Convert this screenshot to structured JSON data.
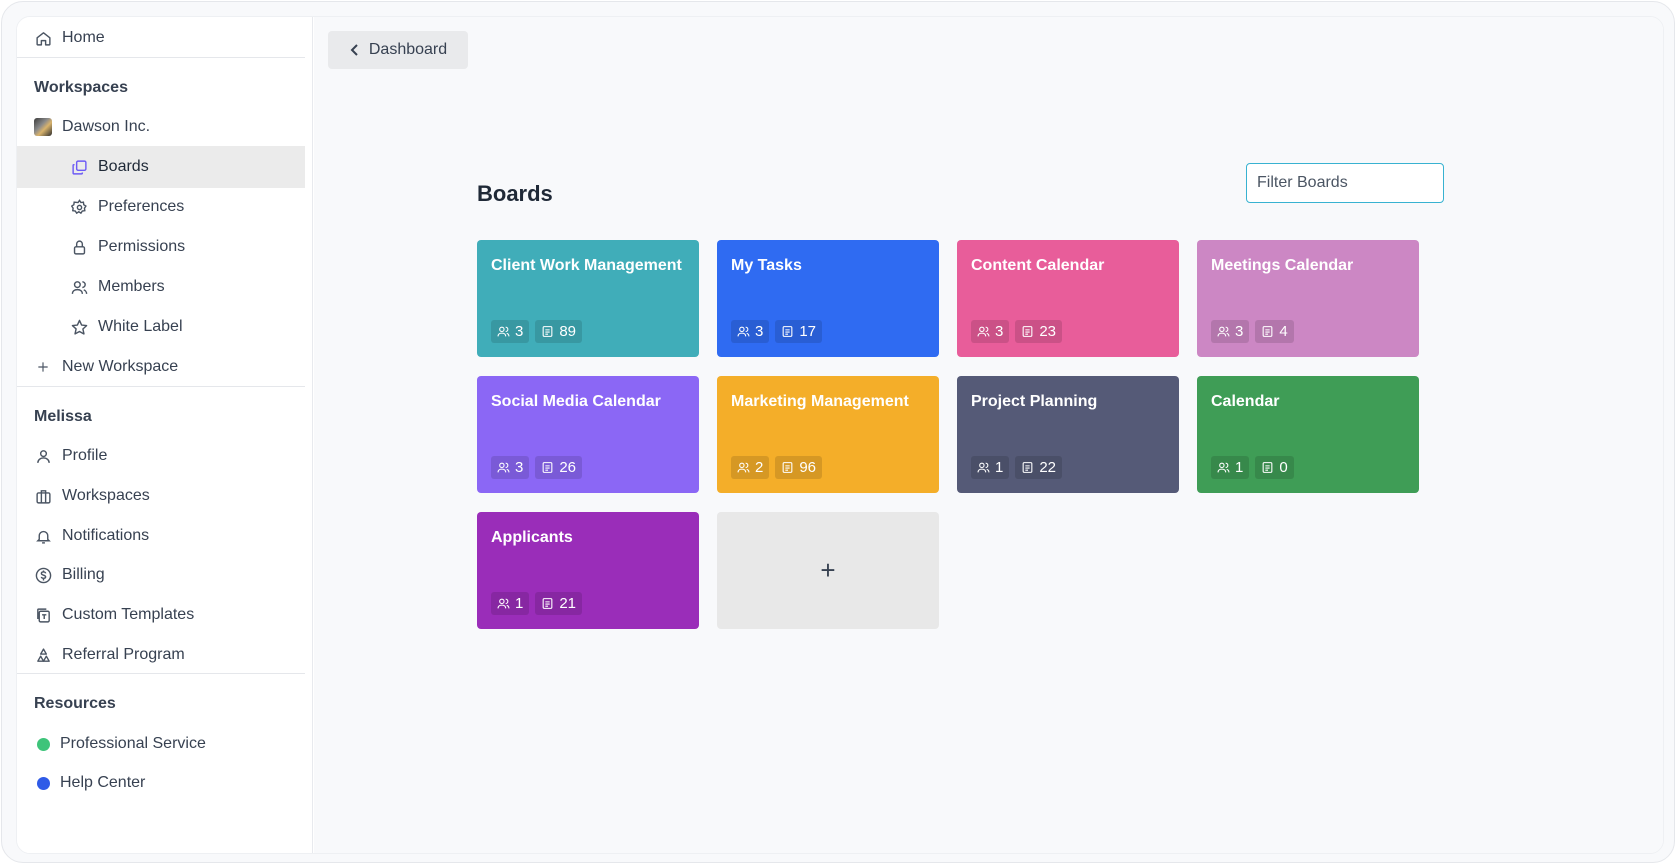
{
  "sidebar": {
    "home": "Home",
    "workspaces_heading": "Workspaces",
    "workspace_name": "Dawson Inc.",
    "ws_items": [
      "Boards",
      "Preferences",
      "Permissions",
      "Members",
      "White Label"
    ],
    "new_workspace": "New Workspace",
    "user_heading": "Melissa",
    "user_items": [
      "Profile",
      "Workspaces",
      "Notifications",
      "Billing",
      "Custom Templates",
      "Referral Program"
    ],
    "resources_heading": "Resources",
    "resource_items": [
      "Professional Service",
      "Help Center"
    ],
    "active_item": "Boards",
    "accent": "#6d5bf5"
  },
  "main": {
    "back_label": "Dashboard",
    "title": "Boards",
    "filter_placeholder": "Filter Boards",
    "add_label": "+"
  },
  "boards": [
    {
      "title": "Client Work Management",
      "members": "3",
      "items": "89",
      "color": "#40adb9"
    },
    {
      "title": "My Tasks",
      "members": "3",
      "items": "17",
      "color": "#2f6bf2"
    },
    {
      "title": "Content Calendar",
      "members": "3",
      "items": "23",
      "color": "#e85d9a"
    },
    {
      "title": "Meetings Calendar",
      "members": "3",
      "items": "4",
      "color": "#cc87c4"
    },
    {
      "title": "Social Media Calendar",
      "members": "3",
      "items": "26",
      "color": "#8b67f5"
    },
    {
      "title": "Marketing Management",
      "members": "2",
      "items": "96",
      "color": "#f4ae29"
    },
    {
      "title": "Project Planning",
      "members": "1",
      "items": "22",
      "color": "#555a77"
    },
    {
      "title": "Calendar",
      "members": "1",
      "items": "0",
      "color": "#3f9d56"
    },
    {
      "title": "Applicants",
      "members": "1",
      "items": "21",
      "color": "#9a2db9"
    }
  ]
}
